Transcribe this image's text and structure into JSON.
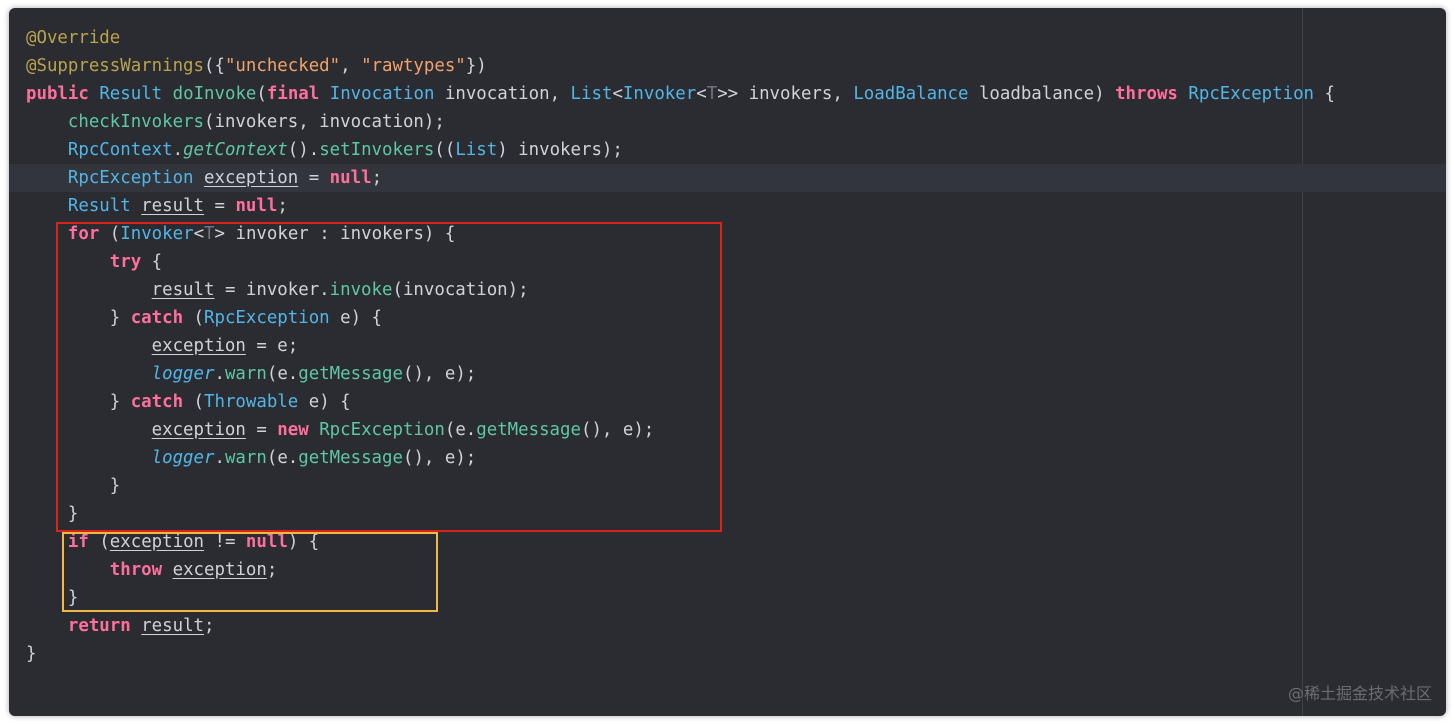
{
  "colors": {
    "background": "#2b2c32",
    "annotation": "#b9a34c",
    "keyword": "#ff6f9c",
    "type": "#51b6e6",
    "method": "#5ec7a4",
    "string": "#f2a26a",
    "plain": "#cfd3d8",
    "box_red": "#d8231b",
    "box_yellow": "#f0b846"
  },
  "code_lines": [
    {
      "highlight": false,
      "tokens": [
        {
          "t": "@Override",
          "c": "ann"
        }
      ]
    },
    {
      "highlight": false,
      "tokens": [
        {
          "t": "@SuppressWarnings",
          "c": "ann"
        },
        {
          "t": "({"
        },
        {
          "t": "\"unchecked\"",
          "c": "str"
        },
        {
          "t": ", "
        },
        {
          "t": "\"rawtypes\"",
          "c": "str"
        },
        {
          "t": "})"
        }
      ]
    },
    {
      "highlight": false,
      "tokens": [
        {
          "t": "public",
          "c": "kw"
        },
        {
          "t": " "
        },
        {
          "t": "Result",
          "c": "type"
        },
        {
          "t": " "
        },
        {
          "t": "doInvoke",
          "c": "method"
        },
        {
          "t": "("
        },
        {
          "t": "final",
          "c": "kw"
        },
        {
          "t": " "
        },
        {
          "t": "Invocation",
          "c": "type"
        },
        {
          "t": " invocation, "
        },
        {
          "t": "List",
          "c": "type"
        },
        {
          "t": "<"
        },
        {
          "t": "Invoker",
          "c": "type"
        },
        {
          "t": "<"
        },
        {
          "t": "T",
          "c": "tvar"
        },
        {
          "t": ">> invokers, "
        },
        {
          "t": "LoadBalance",
          "c": "type"
        },
        {
          "t": " loadbalance) "
        },
        {
          "t": "throws",
          "c": "kw"
        },
        {
          "t": " "
        },
        {
          "t": "RpcException",
          "c": "type"
        },
        {
          "t": " {"
        }
      ]
    },
    {
      "highlight": false,
      "tokens": [
        {
          "t": "    "
        },
        {
          "t": "checkInvokers",
          "c": "method"
        },
        {
          "t": "(invokers, invocation);"
        }
      ]
    },
    {
      "highlight": false,
      "tokens": [
        {
          "t": "    "
        },
        {
          "t": "RpcContext",
          "c": "type"
        },
        {
          "t": "."
        },
        {
          "t": "getContext",
          "c": "ital"
        },
        {
          "t": "()."
        },
        {
          "t": "setInvokers",
          "c": "method"
        },
        {
          "t": "(("
        },
        {
          "t": "List",
          "c": "type"
        },
        {
          "t": ") invokers);"
        }
      ]
    },
    {
      "highlight": true,
      "tokens": [
        {
          "t": "    "
        },
        {
          "t": "RpcException",
          "c": "type"
        },
        {
          "t": " "
        },
        {
          "t": "exception",
          "c": "ul"
        },
        {
          "t": " = "
        },
        {
          "t": "null",
          "c": "kw"
        },
        {
          "t": ";"
        }
      ]
    },
    {
      "highlight": false,
      "tokens": [
        {
          "t": "    "
        },
        {
          "t": "Result",
          "c": "type"
        },
        {
          "t": " "
        },
        {
          "t": "result",
          "c": "ul"
        },
        {
          "t": " = "
        },
        {
          "t": "null",
          "c": "kw"
        },
        {
          "t": ";"
        }
      ]
    },
    {
      "highlight": false,
      "tokens": [
        {
          "t": "    "
        },
        {
          "t": "for",
          "c": "kw"
        },
        {
          "t": " ("
        },
        {
          "t": "Invoker",
          "c": "type"
        },
        {
          "t": "<"
        },
        {
          "t": "T",
          "c": "tvar"
        },
        {
          "t": "> invoker : invokers) {"
        }
      ]
    },
    {
      "highlight": false,
      "tokens": [
        {
          "t": "        "
        },
        {
          "t": "try",
          "c": "kw"
        },
        {
          "t": " {"
        }
      ]
    },
    {
      "highlight": false,
      "tokens": [
        {
          "t": "            "
        },
        {
          "t": "result",
          "c": "ul"
        },
        {
          "t": " = invoker."
        },
        {
          "t": "invoke",
          "c": "method"
        },
        {
          "t": "(invocation);"
        }
      ]
    },
    {
      "highlight": false,
      "tokens": [
        {
          "t": "        } "
        },
        {
          "t": "catch",
          "c": "kw"
        },
        {
          "t": " ("
        },
        {
          "t": "RpcException",
          "c": "type"
        },
        {
          "t": " e) {"
        }
      ]
    },
    {
      "highlight": false,
      "tokens": [
        {
          "t": "            "
        },
        {
          "t": "exception",
          "c": "ul"
        },
        {
          "t": " = e;"
        }
      ]
    },
    {
      "highlight": false,
      "tokens": [
        {
          "t": "            "
        },
        {
          "t": "logger",
          "c": "logger"
        },
        {
          "t": "."
        },
        {
          "t": "warn",
          "c": "method"
        },
        {
          "t": "(e."
        },
        {
          "t": "getMessage",
          "c": "method"
        },
        {
          "t": "(), e);"
        }
      ]
    },
    {
      "highlight": false,
      "tokens": [
        {
          "t": "        } "
        },
        {
          "t": "catch",
          "c": "kw"
        },
        {
          "t": " ("
        },
        {
          "t": "Throwable",
          "c": "type"
        },
        {
          "t": " e) {"
        }
      ]
    },
    {
      "highlight": false,
      "tokens": [
        {
          "t": "            "
        },
        {
          "t": "exception",
          "c": "ul"
        },
        {
          "t": " = "
        },
        {
          "t": "new",
          "c": "kw"
        },
        {
          "t": " "
        },
        {
          "t": "RpcException",
          "c": "method"
        },
        {
          "t": "(e."
        },
        {
          "t": "getMessage",
          "c": "method"
        },
        {
          "t": "(), e);"
        }
      ]
    },
    {
      "highlight": false,
      "tokens": [
        {
          "t": "            "
        },
        {
          "t": "logger",
          "c": "logger"
        },
        {
          "t": "."
        },
        {
          "t": "warn",
          "c": "method"
        },
        {
          "t": "(e."
        },
        {
          "t": "getMessage",
          "c": "method"
        },
        {
          "t": "(), e);"
        }
      ]
    },
    {
      "highlight": false,
      "tokens": [
        {
          "t": "        }"
        }
      ]
    },
    {
      "highlight": false,
      "tokens": [
        {
          "t": "    }"
        }
      ]
    },
    {
      "highlight": false,
      "tokens": [
        {
          "t": "    "
        },
        {
          "t": "if",
          "c": "kw"
        },
        {
          "t": " ("
        },
        {
          "t": "exception",
          "c": "ul"
        },
        {
          "t": " != "
        },
        {
          "t": "null",
          "c": "kw"
        },
        {
          "t": ") {"
        }
      ]
    },
    {
      "highlight": false,
      "tokens": [
        {
          "t": "        "
        },
        {
          "t": "throw",
          "c": "kw"
        },
        {
          "t": " "
        },
        {
          "t": "exception",
          "c": "ul"
        },
        {
          "t": ";"
        }
      ]
    },
    {
      "highlight": false,
      "tokens": [
        {
          "t": "    }"
        }
      ]
    },
    {
      "highlight": false,
      "tokens": [
        {
          "t": "    "
        },
        {
          "t": "return",
          "c": "kw"
        },
        {
          "t": " "
        },
        {
          "t": "result",
          "c": "ul"
        },
        {
          "t": ";"
        }
      ]
    },
    {
      "highlight": false,
      "tokens": [
        {
          "t": "}"
        }
      ]
    }
  ],
  "watermark": "@稀土掘金技术社区"
}
